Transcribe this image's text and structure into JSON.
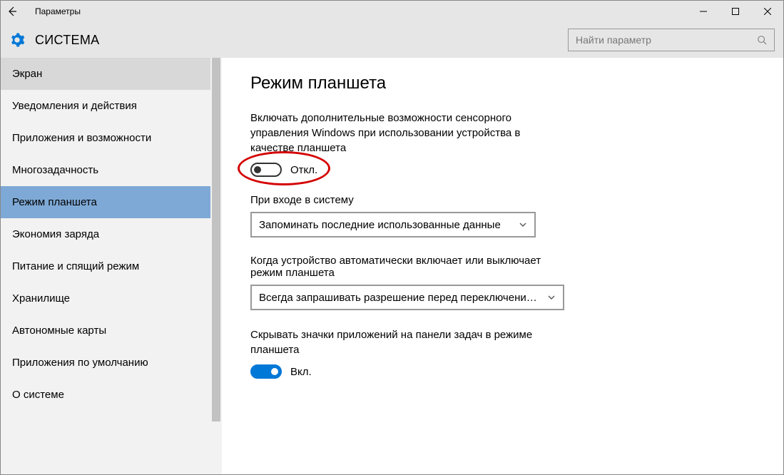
{
  "window": {
    "title": "Параметры"
  },
  "header": {
    "title": "СИСТЕМА",
    "search_placeholder": "Найти параметр"
  },
  "sidebar": {
    "items": [
      {
        "label": "Экран",
        "state": "hover"
      },
      {
        "label": "Уведомления и действия",
        "state": ""
      },
      {
        "label": "Приложения и возможности",
        "state": ""
      },
      {
        "label": "Многозадачность",
        "state": ""
      },
      {
        "label": "Режим планшета",
        "state": "selected"
      },
      {
        "label": "Экономия заряда",
        "state": ""
      },
      {
        "label": "Питание и спящий режим",
        "state": ""
      },
      {
        "label": "Хранилище",
        "state": ""
      },
      {
        "label": "Автономные карты",
        "state": ""
      },
      {
        "label": "Приложения по умолчанию",
        "state": ""
      },
      {
        "label": "О системе",
        "state": ""
      }
    ]
  },
  "page": {
    "title": "Режим планшета",
    "group1": {
      "desc": "Включать дополнительные возможности сенсорного управления Windows при использовании устройства в качестве планшета",
      "toggle_label": "Откл.",
      "toggle_on": false
    },
    "group2": {
      "label": "При входе в систему",
      "value": "Запоминать последние использованные данные"
    },
    "group3": {
      "label": "Когда устройство автоматически включает или выключает режим планшета",
      "value": "Всегда запрашивать разрешение перед переключением…"
    },
    "group4": {
      "desc": "Скрывать значки приложений на панели задач в режиме планшета",
      "toggle_label": "Вкл.",
      "toggle_on": true
    }
  }
}
